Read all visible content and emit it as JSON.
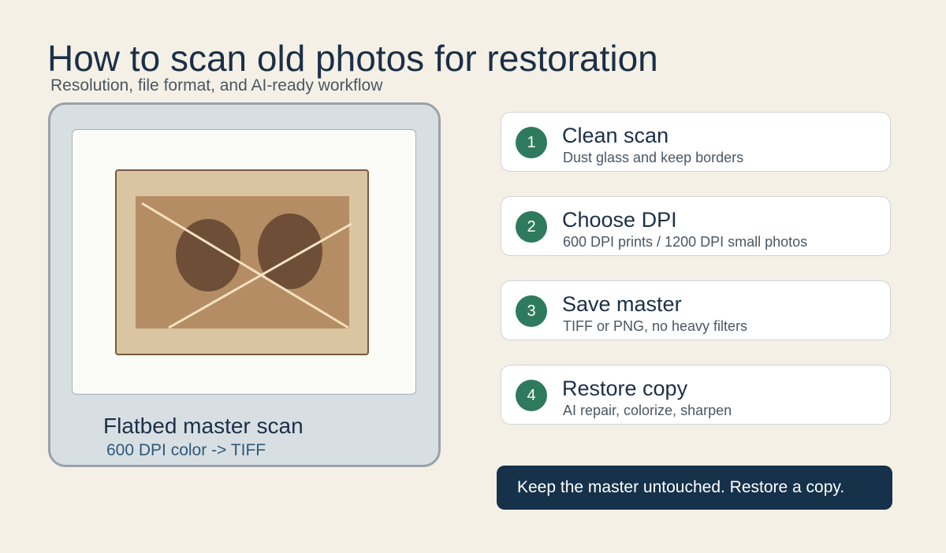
{
  "header": {
    "title": "How to scan old photos for restoration",
    "subtitle": "Resolution, file format, and AI-ready workflow"
  },
  "scanner": {
    "label": "Flatbed master scan",
    "sublabel": "600 DPI color -> TIFF"
  },
  "steps": [
    {
      "number": "1",
      "title": "Clean scan",
      "description": "Dust glass and keep borders"
    },
    {
      "number": "2",
      "title": "Choose DPI",
      "description": "600 DPI prints / 1200 DPI small photos"
    },
    {
      "number": "3",
      "title": "Save master",
      "description": "TIFF or PNG, no heavy filters"
    },
    {
      "number": "4",
      "title": "Restore copy",
      "description": "AI repair, colorize, sharpen"
    }
  ],
  "callout": {
    "text": "Keep the master untouched. Restore a copy."
  },
  "colors": {
    "background": "#f5f0e6",
    "text_primary": "#1b3047",
    "accent_green": "#2e7a5e",
    "callout_bg": "#16314a",
    "photo_frame": "#d9c5a2",
    "photo_inner": "#b58d64",
    "photo_subjects": "#6e4e37",
    "scratch": "#f4e2c0"
  },
  "icons": {
    "photo": "damaged-photo-icon"
  }
}
